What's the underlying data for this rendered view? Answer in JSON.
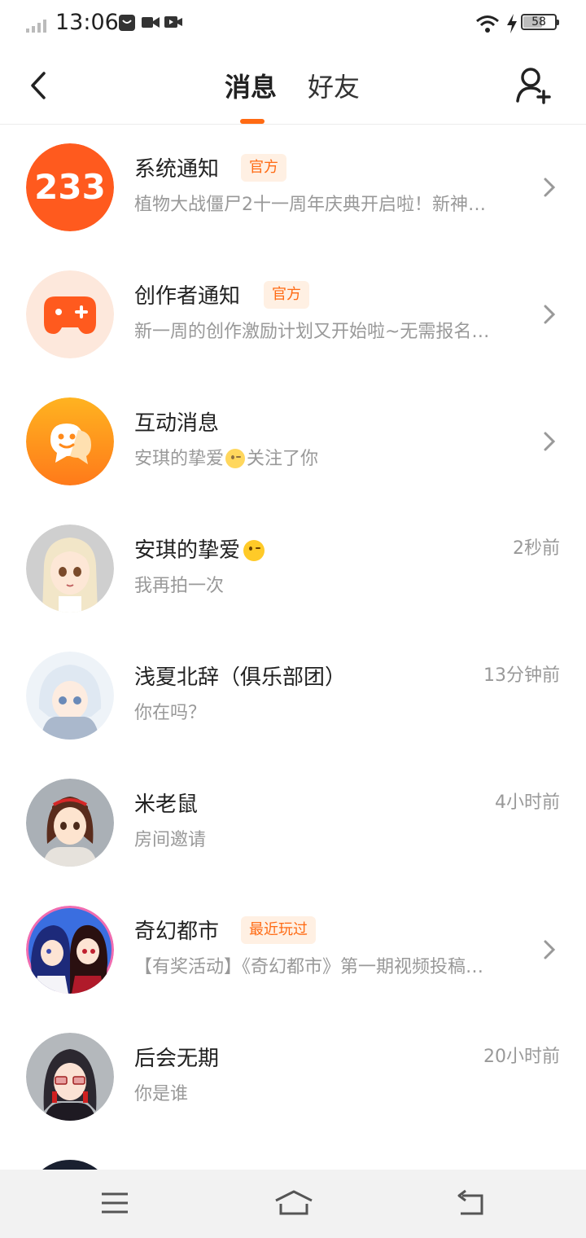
{
  "status_bar": {
    "time": "13:06",
    "battery": "58",
    "battery_percent": 58,
    "icons": [
      "signal-icon",
      "mail-icon",
      "video-call-icon",
      "screen-record-icon",
      "wifi-icon",
      "charging-icon",
      "battery-icon"
    ]
  },
  "header": {
    "tabs": [
      {
        "label": "消息",
        "active": true
      },
      {
        "label": "好友",
        "active": false
      }
    ],
    "accent": "#ff6a13",
    "icons": [
      "back-icon",
      "add-friend-icon"
    ]
  },
  "messages": [
    {
      "title": "系统通知",
      "tag": "官方",
      "subtitle": "植物大战僵尸2十一周年庆典开启啦！新神…",
      "avatar_text": "233",
      "avatar_color": "#ff5a1e",
      "has_arrow": true
    },
    {
      "title": "创作者通知",
      "tag": "官方",
      "subtitle": "新一周的创作激励计划又开始啦~无需报名…",
      "avatar_color": "#fde8dc",
      "has_arrow": true
    },
    {
      "title": "互动消息",
      "subtitle_prefix": "安琪的挚爱",
      "subtitle_suffix": "关注了你",
      "avatar_color": "#ffa726",
      "has_arrow": true
    },
    {
      "title": "安琪的挚爱",
      "time": "2秒前",
      "subtitle": "我再拍一次"
    },
    {
      "title": "浅夏北辞（俱乐部团）",
      "time": "13分钟前",
      "subtitle": "你在吗？"
    },
    {
      "title": "米老鼠",
      "time": "4小时前",
      "subtitle": "房间邀请"
    },
    {
      "title": "奇幻都市",
      "tag": "最近玩过",
      "subtitle": "【有奖活动】《奇幻都市》第一期视频投稿…",
      "has_arrow": true
    },
    {
      "title": "后会无期",
      "time": "20小时前",
      "subtitle": "你是谁"
    }
  ],
  "nav": {
    "icons": [
      "menu-icon",
      "home-icon",
      "back-nav-icon"
    ]
  }
}
